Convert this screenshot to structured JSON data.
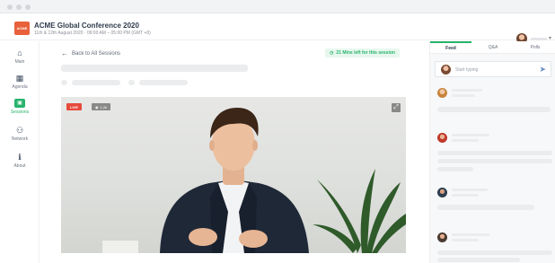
{
  "header": {
    "logo_text": "ACME",
    "event_title": "ACME Global Conference 2020",
    "event_date": "11th & 12th August 2020 · 09:00 AM – 05:00 PM (GMT +8)"
  },
  "nav": {
    "items": [
      {
        "label": "Main",
        "icon": "home-icon",
        "glyph": "⌂"
      },
      {
        "label": "Agenda",
        "icon": "calendar-icon",
        "glyph": "▦"
      },
      {
        "label": "Sessions",
        "icon": "sessions-icon",
        "glyph": "▣",
        "active": true
      },
      {
        "label": "Network",
        "icon": "people-icon",
        "glyph": "⚇"
      },
      {
        "label": "About",
        "icon": "info-icon",
        "glyph": "ℹ"
      }
    ]
  },
  "main": {
    "back_label": "Back to All Sessions",
    "timer": "21 Mins left for this session",
    "video": {
      "live_label": "LIVE",
      "viewer_label": "1,2k"
    }
  },
  "sidepanel": {
    "tabs": [
      {
        "label": "Feed",
        "active": true
      },
      {
        "label": "Q&A"
      },
      {
        "label": "Polls"
      }
    ],
    "compose_placeholder": "Start typing"
  },
  "colors": {
    "accent": "#27b36b",
    "live": "#e64a3b",
    "logo": "#e8613a"
  }
}
